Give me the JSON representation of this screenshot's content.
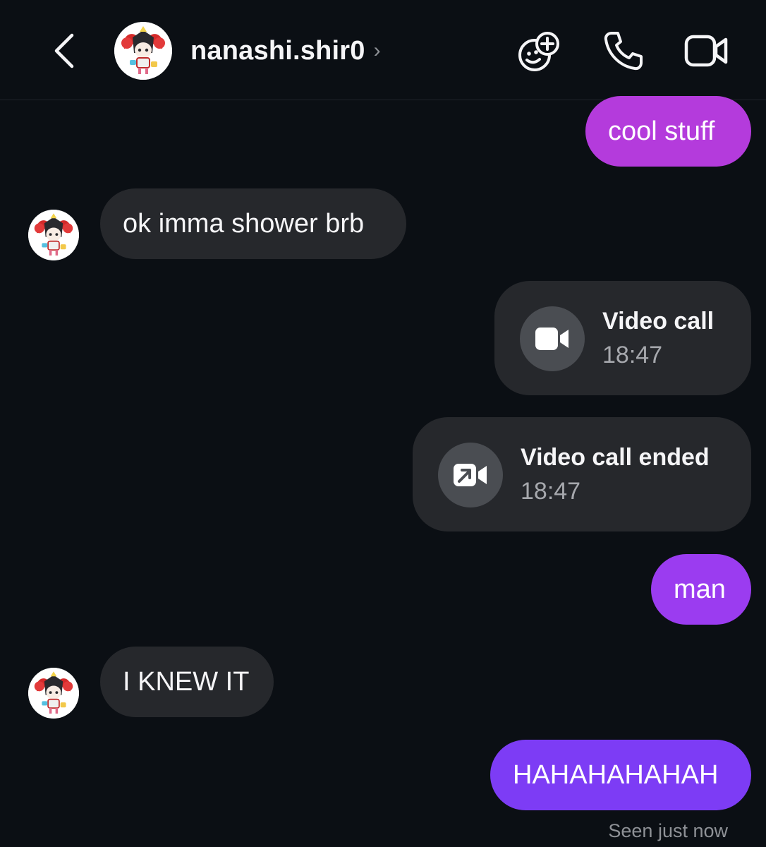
{
  "header": {
    "username": "nanashi.shir0",
    "chevron": "›",
    "icons": [
      "back-chevron-icon",
      "avatar",
      "effects-icon",
      "phone-icon",
      "video-camera-icon"
    ]
  },
  "colors": {
    "background": "#0b0f14",
    "incoming_bubble": "#26282c",
    "outgoing_bubble_top": "#b43bdc",
    "outgoing_bubble_mid": "#9b3cf0",
    "outgoing_bubble_bottom": "#7d3cf5",
    "call_icon_circle": "#4a4d52"
  },
  "messages": [
    {
      "side": "out",
      "text": "cool stuff"
    },
    {
      "side": "in",
      "text": "ok imma shower brb"
    },
    {
      "type": "call",
      "title": "Video call",
      "time": "18:47",
      "icon": "video-camera-icon"
    },
    {
      "type": "call",
      "title": "Video call ended",
      "time": "18:47",
      "icon": "video-call-ended-icon"
    },
    {
      "side": "out",
      "text": "man"
    },
    {
      "side": "in",
      "text": "I KNEW IT"
    },
    {
      "side": "out",
      "text": "HAHAHAHAHAH"
    }
  ],
  "status": {
    "seen": "Seen just now"
  }
}
